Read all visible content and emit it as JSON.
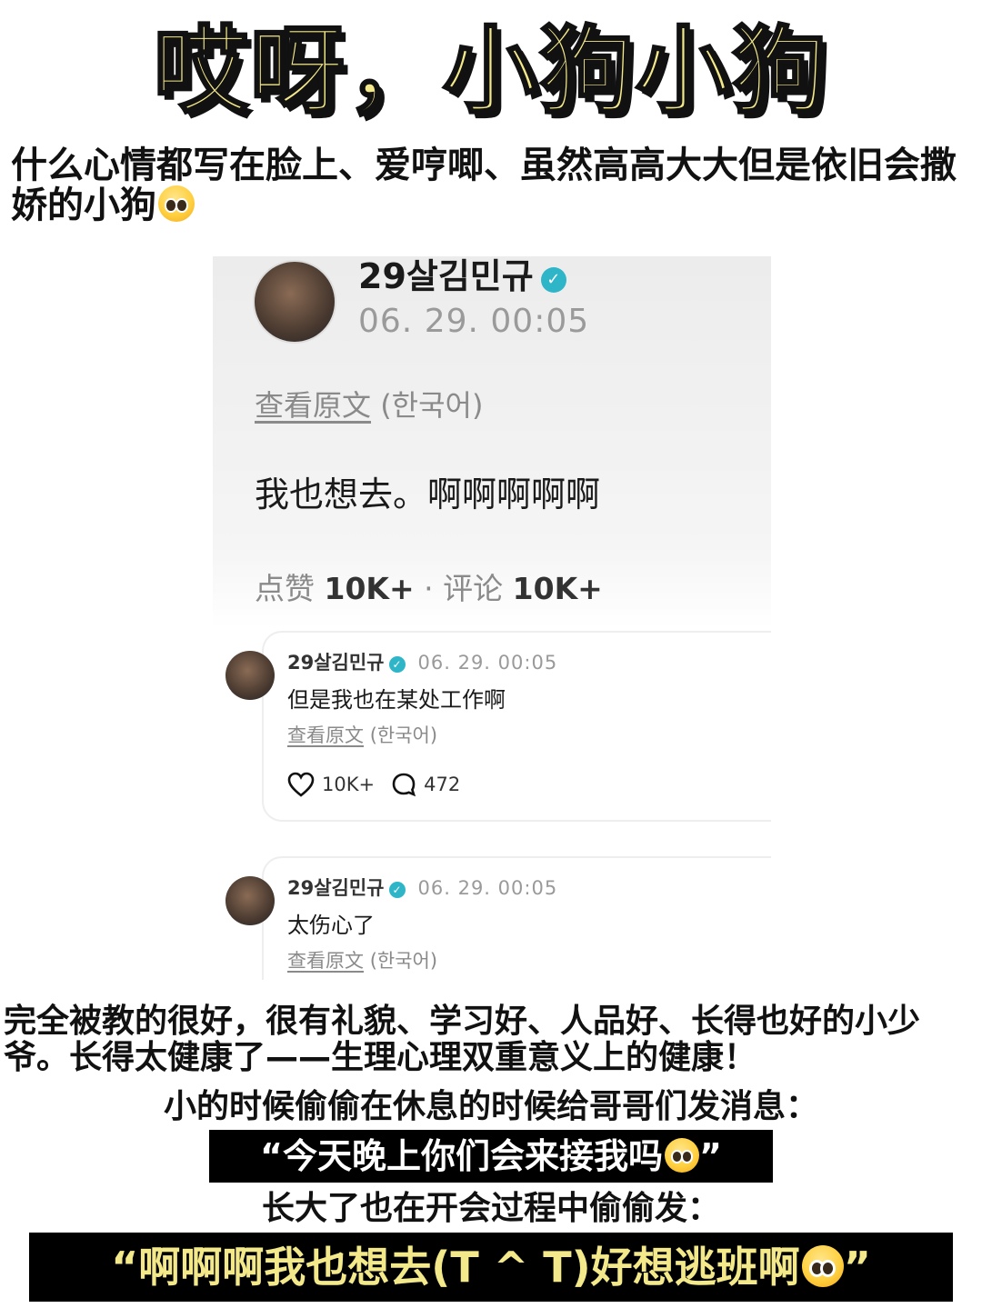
{
  "headline": "哎呀，小狗小狗",
  "intro": "什么心情都写在脸上、爱哼唧、虽然高高大大但是依旧会撒娇的小狗",
  "post": {
    "username": "29살김민규",
    "timestamp": "06. 29. 00:05",
    "view_original": "查看原文",
    "language": "(한국어)",
    "text": "我也想去。啊啊啊啊啊",
    "likes_label": "点赞",
    "likes_count": "10K+",
    "separator": "·",
    "comments_label": "评论",
    "comments_count": "10K+"
  },
  "replies": [
    {
      "username": "29살김민규",
      "timestamp": "06. 29. 00:05",
      "text": "但是我也在某处工作啊",
      "view_original": "查看原文",
      "language": "(한국어)",
      "likes": "10K+",
      "comments": "472"
    },
    {
      "username": "29살김민규",
      "timestamp": "06. 29. 00:05",
      "text": "太伤心了",
      "view_original": "查看原文",
      "language": "(한국어)"
    }
  ],
  "paragraph": "完全被教的很好，很有礼貌、学习好、人品好、长得也好的小少爷。长得太健康了——生理心理双重意义上的健康！",
  "line3": "小的时候偷偷在休息的时候给哥哥们发消息：",
  "quote1": "“今天晚上你们会来接我吗",
  "quote1_end": "”",
  "line5": "长大了也在开会过程中偷偷发：",
  "quote2": "“啊啊啊我也想去(T ^ T)好想逃班啊",
  "quote2_end": "”",
  "colors": {
    "headline_fill": "#f4e98a",
    "verified": "#2fb5c8",
    "muted_text": "#9a9a9a",
    "bar_background": "#000000"
  },
  "icons": [
    "pleading-face-emoji",
    "verified-check-icon",
    "heart-icon",
    "comment-bubble-icon"
  ]
}
